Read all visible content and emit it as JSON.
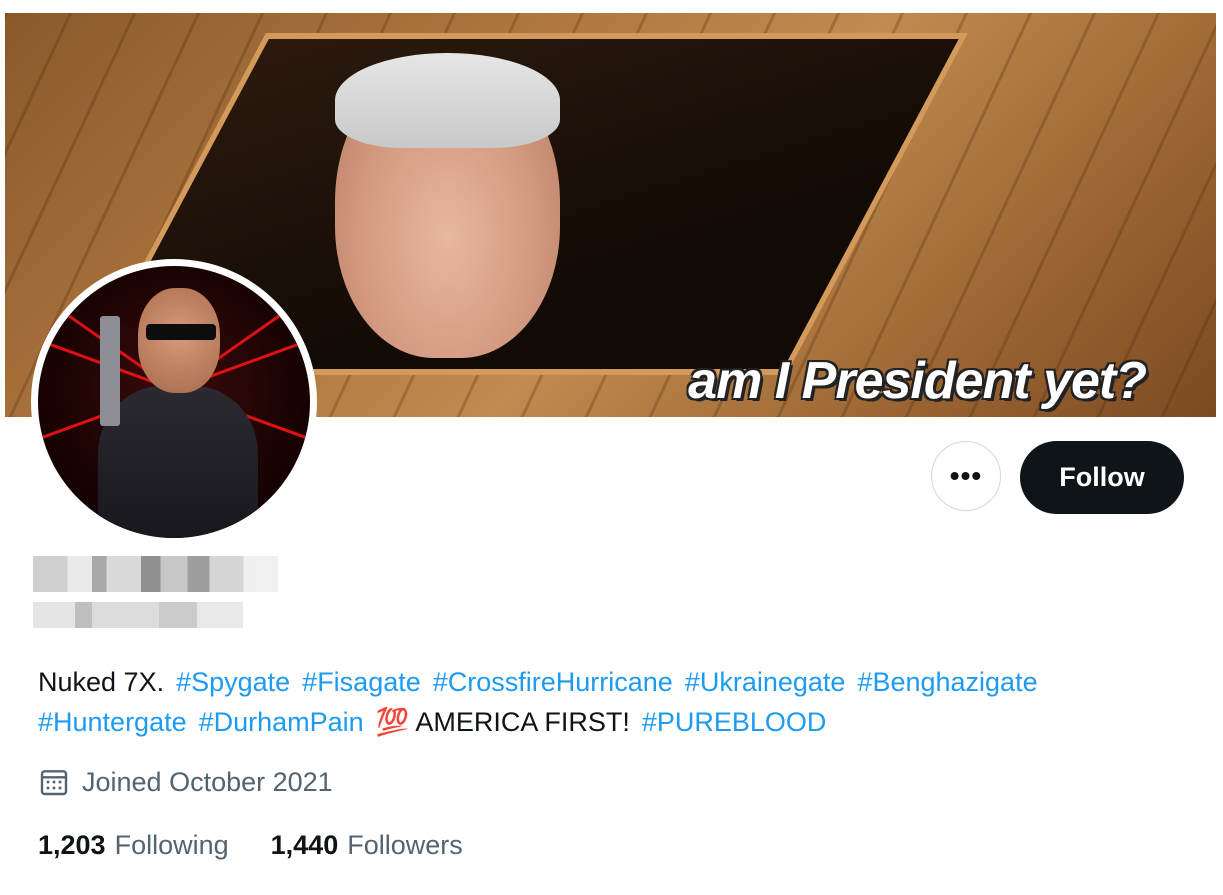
{
  "banner": {
    "caption": "am I President yet?"
  },
  "profile": {
    "bio_segments": [
      {
        "type": "text",
        "text": "Nuked 7X."
      },
      {
        "type": "tag",
        "text": "#Spygate"
      },
      {
        "type": "tag",
        "text": "#Fisagate"
      },
      {
        "type": "tag",
        "text": "#CrossfireHurricane"
      },
      {
        "type": "tag",
        "text": "#Ukrainegate"
      },
      {
        "type": "tag",
        "text": "#Benghazigate"
      },
      {
        "type": "tag",
        "text": "#Huntergate"
      },
      {
        "type": "tag",
        "text": "#DurhamPain"
      },
      {
        "type": "text",
        "text": "💯 AMERICA FIRST!"
      },
      {
        "type": "tag",
        "text": "#PUREBLOOD"
      }
    ],
    "joined": "Joined October 2021",
    "following_count": "1,203",
    "following_label": "Following",
    "followers_count": "1,440",
    "followers_label": "Followers"
  },
  "actions": {
    "more_label": "•••",
    "follow_label": "Follow"
  },
  "colors": {
    "link": "#1d9bf0",
    "primary_text": "#0f1419",
    "secondary_text": "#536471",
    "follow_bg": "#0f1419"
  },
  "icons": {
    "more": "more-icon",
    "calendar": "calendar-icon"
  }
}
